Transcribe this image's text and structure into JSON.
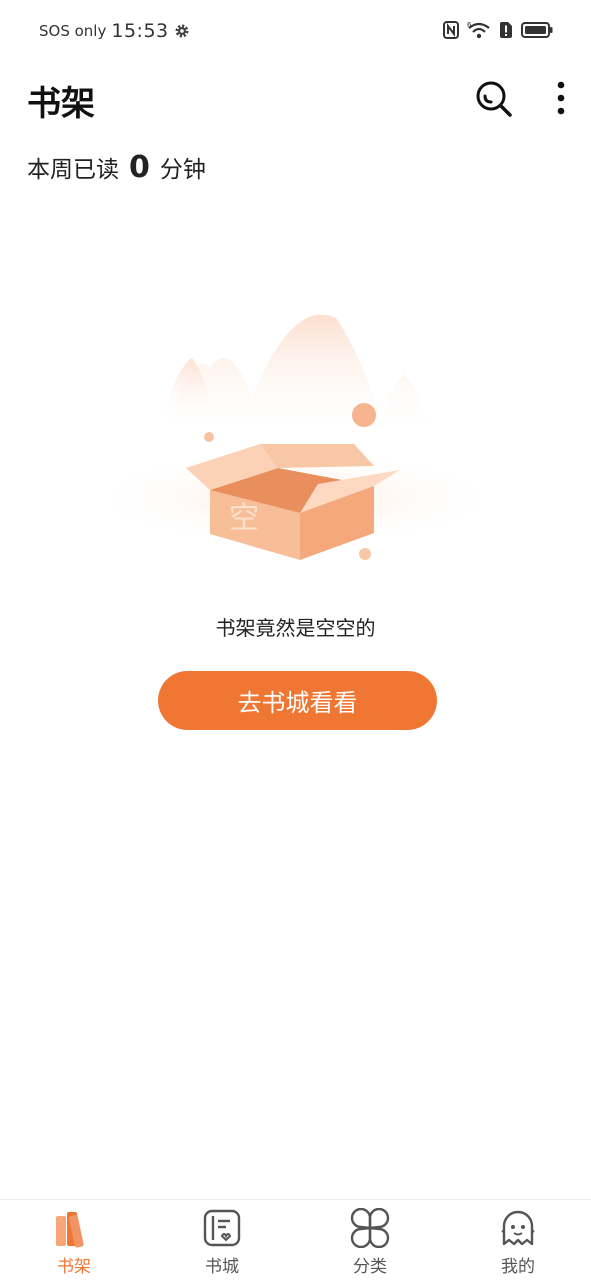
{
  "status_bar": {
    "carrier": "SOS only",
    "time": "15:53",
    "signal_badge": "6"
  },
  "header": {
    "title": "书架"
  },
  "reading_stats": {
    "prefix": "本周已读",
    "minutes": "0",
    "unit": "分钟"
  },
  "empty_state": {
    "box_label": "空",
    "message": "书架竟然是空空的",
    "button_label": "去书城看看"
  },
  "colors": {
    "accent": "#ef7633",
    "box": "#f7b68c",
    "inactive": "#555555"
  },
  "bottom_nav": {
    "items": [
      {
        "label": "书架",
        "icon": "bookshelf-icon",
        "active": true
      },
      {
        "label": "书城",
        "icon": "book-store-icon",
        "active": false
      },
      {
        "label": "分类",
        "icon": "category-icon",
        "active": false
      },
      {
        "label": "我的",
        "icon": "profile-ghost-icon",
        "active": false
      }
    ]
  }
}
